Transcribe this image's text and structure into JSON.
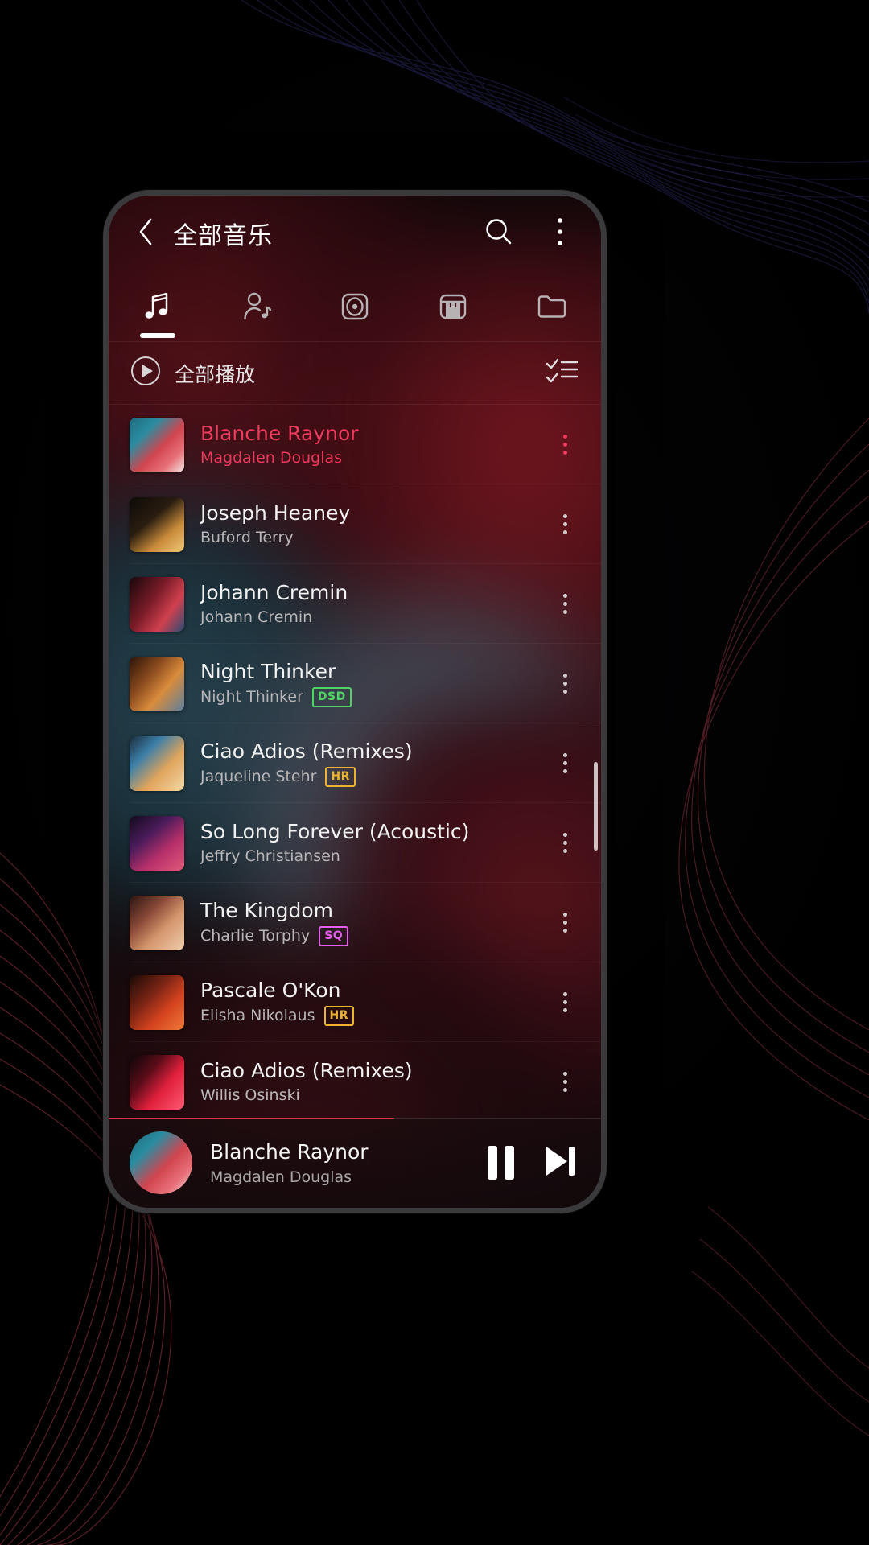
{
  "app": {
    "header": {
      "back_icon": "chevron-left-icon",
      "title": "全部音乐",
      "search_icon": "search-icon",
      "overflow_icon": "more-vertical-icon"
    },
    "tabs": [
      {
        "name": "songs",
        "icon": "music-note-icon",
        "active": true
      },
      {
        "name": "artists",
        "icon": "artist-icon",
        "active": false
      },
      {
        "name": "albums",
        "icon": "album-disc-icon",
        "active": false
      },
      {
        "name": "genres",
        "icon": "piano-keys-icon",
        "active": false
      },
      {
        "name": "folders",
        "icon": "folder-icon",
        "active": false
      }
    ],
    "play_all": {
      "play_icon": "play-circle-icon",
      "label": "全部播放",
      "multiselect_icon": "checklist-icon"
    },
    "songs": [
      {
        "title": "Blanche Raynor",
        "artist": "Magdalen Douglas",
        "badge": "",
        "playing": true,
        "art": "a1"
      },
      {
        "title": "Joseph Heaney",
        "artist": "Buford Terry",
        "badge": "",
        "playing": false,
        "art": "a2"
      },
      {
        "title": "Johann Cremin",
        "artist": "Johann Cremin",
        "badge": "",
        "playing": false,
        "art": "a3"
      },
      {
        "title": "Night Thinker",
        "artist": "Night Thinker",
        "badge": "DSD",
        "playing": false,
        "art": "a4"
      },
      {
        "title": "Ciao Adios (Remixes)",
        "artist": "Jaqueline Stehr",
        "badge": "HR",
        "playing": false,
        "art": "a5"
      },
      {
        "title": "So Long Forever (Acoustic)",
        "artist": "Jeffry Christiansen",
        "badge": "",
        "playing": false,
        "art": "a6"
      },
      {
        "title": "The Kingdom",
        "artist": "Charlie Torphy",
        "badge": "SQ",
        "playing": false,
        "art": "a7"
      },
      {
        "title": "Pascale O'Kon",
        "artist": "Elisha Nikolaus",
        "badge": "HR",
        "playing": false,
        "art": "a8"
      },
      {
        "title": "Ciao Adios (Remixes)",
        "artist": "Willis Osinski",
        "badge": "",
        "playing": false,
        "art": "a9"
      }
    ],
    "mini_player": {
      "title": "Blanche Raynor",
      "artist": "Magdalen Douglas",
      "pause_icon": "pause-icon",
      "next_icon": "skip-next-icon",
      "progress_percent": 58
    },
    "colors": {
      "accent_playing": "#ee3a5c",
      "badge_dsd": "#4fd463",
      "badge_hr": "#edb42f",
      "badge_sq": "#e261ec",
      "progress": "#d9304f",
      "text_primary": "#f2f2f2",
      "text_secondary": "#b9b6b8"
    }
  }
}
